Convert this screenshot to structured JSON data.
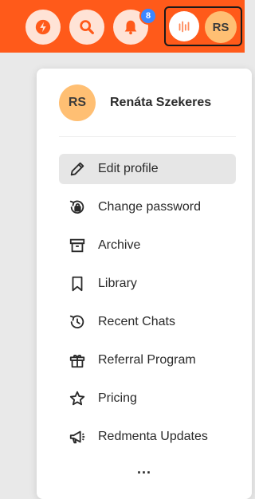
{
  "topbar": {
    "notification_count": "8",
    "user_initials": "RS",
    "accent_color": "#ff5a1a"
  },
  "profile": {
    "initials": "RS",
    "name": "Renáta Szekeres"
  },
  "menu": {
    "items": [
      {
        "label": "Edit profile",
        "icon": "pencil-icon",
        "active": true
      },
      {
        "label": "Change password",
        "icon": "lock-reset-icon"
      },
      {
        "label": "Archive",
        "icon": "archive-box-icon"
      },
      {
        "label": "Library",
        "icon": "bookmark-icon"
      },
      {
        "label": "Recent Chats",
        "icon": "history-icon"
      },
      {
        "label": "Referral Program",
        "icon": "gift-icon"
      },
      {
        "label": "Pricing",
        "icon": "star-icon"
      },
      {
        "label": "Redmenta Updates",
        "icon": "megaphone-icon"
      }
    ],
    "more": "..."
  }
}
